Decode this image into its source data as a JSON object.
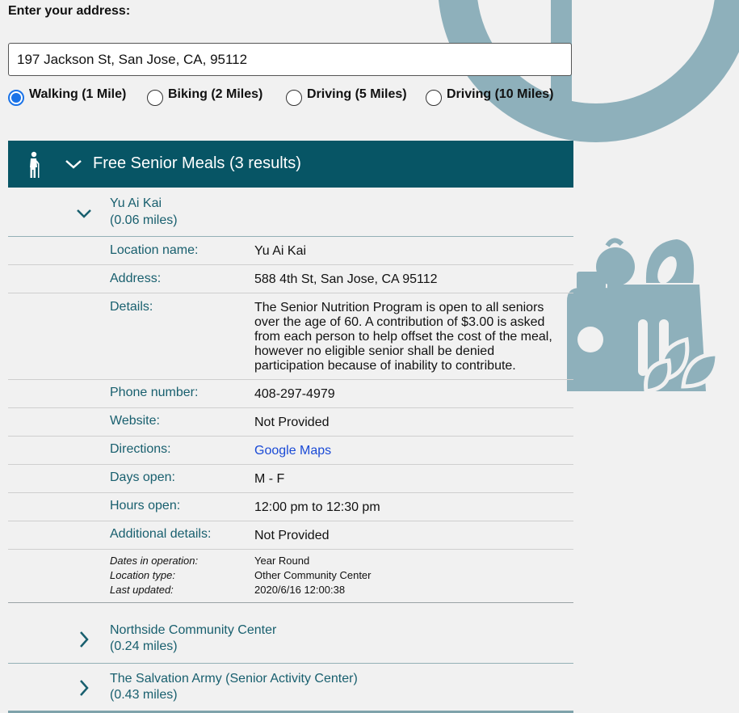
{
  "address": {
    "label": "Enter your address:",
    "value": "197 Jackson St, San Jose, CA, 95112"
  },
  "travel_modes": [
    {
      "label": "Walking (1 Mile)",
      "checked": true
    },
    {
      "label": "Biking (2 Miles)",
      "checked": false
    },
    {
      "label": "Driving (5 Miles)",
      "checked": false
    },
    {
      "label": "Driving (10 Miles)",
      "checked": false
    }
  ],
  "category": {
    "title": "Free Senior Meals (3 results)",
    "icon": "senior-person-icon",
    "header_color": "#075565"
  },
  "results": [
    {
      "name": "Yu Ai Kai",
      "distance": "(0.06 miles)",
      "expanded": true
    },
    {
      "name": "Northside Community Center",
      "distance": "(0.24 miles)",
      "expanded": false
    },
    {
      "name": "The Salvation Army (Senior Activity Center)",
      "distance": "(0.43 miles)",
      "expanded": false
    }
  ],
  "details": {
    "location_name": {
      "label": "Location name:",
      "value": "Yu Ai Kai"
    },
    "address": {
      "label": "Address:",
      "value": "588 4th St, San Jose, CA 95112"
    },
    "details": {
      "label": "Details:",
      "value": "The Senior Nutrition Program is open to all seniors over the age of 60. A contribution of $3.00 is asked from each person to help offset the cost of the meal, however no eligible senior shall be denied participation because of inability to contribute."
    },
    "phone": {
      "label": "Phone number:",
      "value": "408-297-4979"
    },
    "website": {
      "label": "Website:",
      "value": "Not Provided"
    },
    "directions": {
      "label": "Directions:",
      "value": "Google Maps"
    },
    "days": {
      "label": "Days open:",
      "value": "M - F"
    },
    "hours": {
      "label": "Hours open:",
      "value": "12:00 pm to 12:30 pm"
    },
    "additional": {
      "label": "Additional details:",
      "value": "Not Provided"
    }
  },
  "meta": {
    "dates_label": "Dates in operation:",
    "dates_value": "Year Round",
    "type_label": "Location type:",
    "type_value": "Other Community Center",
    "updated_label": "Last updated:",
    "updated_value": "2020/6/16 12:00:38"
  },
  "colors": {
    "accent": "#075565",
    "link": "#1a4ad6",
    "radio": "#1a73e8",
    "decoration": "#8eb0bb"
  },
  "decorations": [
    "logo-watermark",
    "grocery-bag-icon"
  ]
}
